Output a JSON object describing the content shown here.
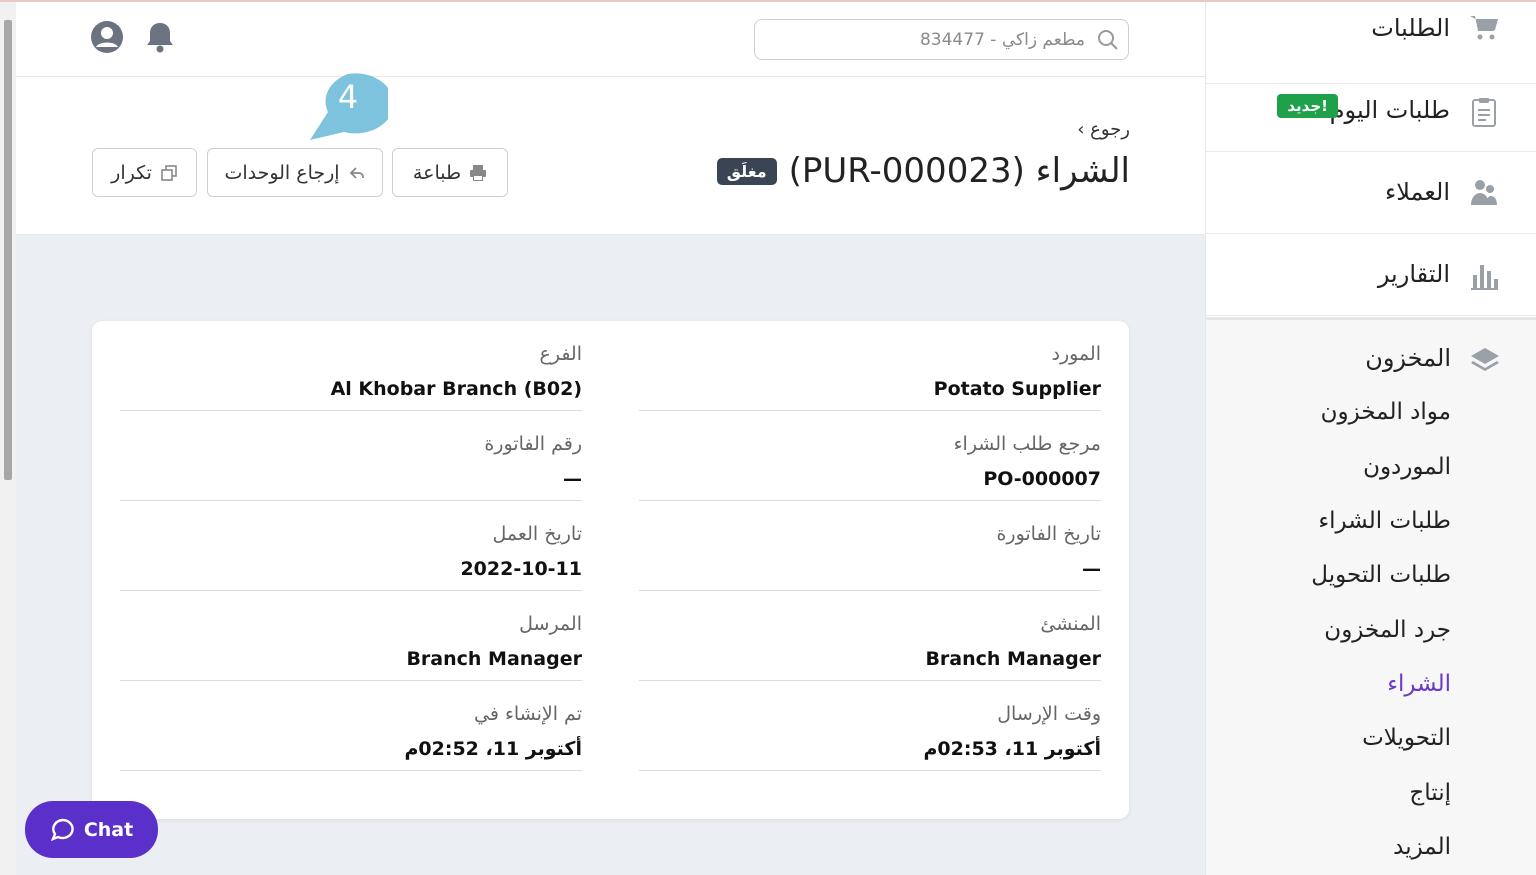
{
  "sidebar": {
    "orders": "الطلبات",
    "today_orders": "طلبات اليوم",
    "today_badge": "جديد!",
    "customers": "العملاء",
    "reports": "التقارير",
    "inventory": {
      "label": "المخزون",
      "items": [
        "مواد المخزون",
        "الموردون",
        "طلبات الشراء",
        "طلبات التحويل",
        "جرد المخزون",
        "الشراء",
        "التحويلات",
        "إنتاج",
        "المزيد"
      ],
      "active": "الشراء"
    }
  },
  "header": {
    "search_placeholder": "مطعم زاكي - 834477"
  },
  "page": {
    "back_label": "رجوع",
    "title": "الشراء (PUR-000023)",
    "status": "مغلَق",
    "print_label": "طباعة",
    "return_units_label": "إرجاع الوحدات",
    "duplicate_label": "تكرار",
    "tooltip_number": "4"
  },
  "details": {
    "supplier_label": "المورد",
    "supplier_value": "Potato Supplier",
    "branch_label": "الفرع",
    "branch_value": "Al Khobar Branch (B02)",
    "po_ref_label": "مرجع طلب الشراء",
    "po_ref_value": "PO-000007",
    "invoice_number_label": "رقم الفاتورة",
    "invoice_number_value": "—",
    "invoice_date_label": "تاريخ الفاتورة",
    "invoice_date_value": "—",
    "business_date_label": "تاريخ العمل",
    "business_date_value": "2022-10-11",
    "creator_label": "المنشئ",
    "creator_value": "Branch Manager",
    "sender_label": "المرسل",
    "sender_value": "Branch Manager",
    "sent_at_label": "وقت الإرسال",
    "sent_at_value": "أكتوبر 11، 02:53م",
    "created_at_label": "تم الإنشاء في",
    "created_at_value": "أكتوبر 11، 02:52م"
  },
  "chat": {
    "label": "Chat"
  },
  "colors": {
    "accent": "#5b2fc9",
    "active_nav": "#6a3bc8",
    "badge_green": "#1fa04a",
    "status_badge": "#3a4554",
    "tooltip": "#7ec3de"
  }
}
